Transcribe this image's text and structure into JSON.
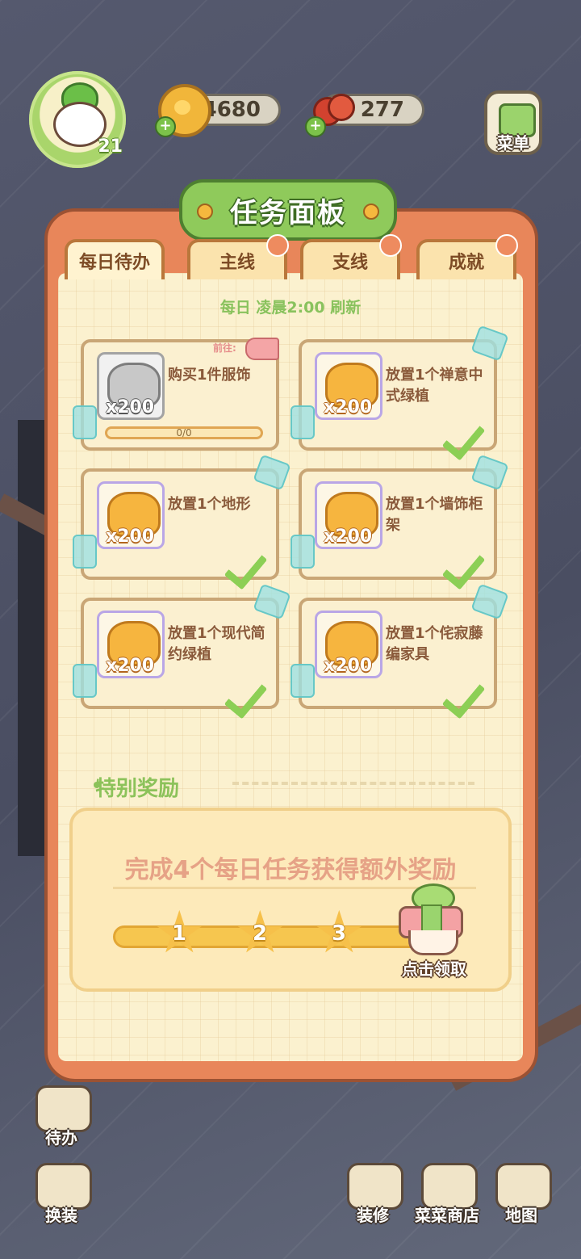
{
  "hud": {
    "level": "21",
    "coins": "4680",
    "cherries": "277",
    "menu_label": "菜单"
  },
  "panel": {
    "title": "任务面板",
    "tabs": [
      {
        "label": "每日待办"
      },
      {
        "label": "主线"
      },
      {
        "label": "支线"
      },
      {
        "label": "成就"
      }
    ],
    "refresh_note": "每日 凌晨2:00 刷新"
  },
  "tasks": [
    {
      "text": "购买1件服饰",
      "reward": "x200",
      "progress": "0/0",
      "goto": "前往:",
      "done": false
    },
    {
      "text": "放置1个禅意中式绿植",
      "reward": "x200",
      "done": true
    },
    {
      "text": "放置1个地形",
      "reward": "x200",
      "done": true
    },
    {
      "text": "放置1个墙饰柜架",
      "reward": "x200",
      "done": true
    },
    {
      "text": "放置1个现代简约绿植",
      "reward": "x200",
      "done": true
    },
    {
      "text": "放置1个侘寂藤编家具",
      "reward": "x200",
      "done": true
    }
  ],
  "special": {
    "title": "特别奖励",
    "desc": "完成4个每日任务获得额外奖励",
    "milestones": [
      "1",
      "2",
      "3"
    ],
    "claim_label": "点击领取"
  },
  "bottom_bar": {
    "todo": "待办",
    "outfit": "换装",
    "decorate": "装修",
    "shop": "菜菜商店",
    "map": "地图"
  },
  "colors": {
    "panel_orange": "#e8865a",
    "green_accent": "#8cc25a",
    "paper": "#fbf1cf"
  }
}
